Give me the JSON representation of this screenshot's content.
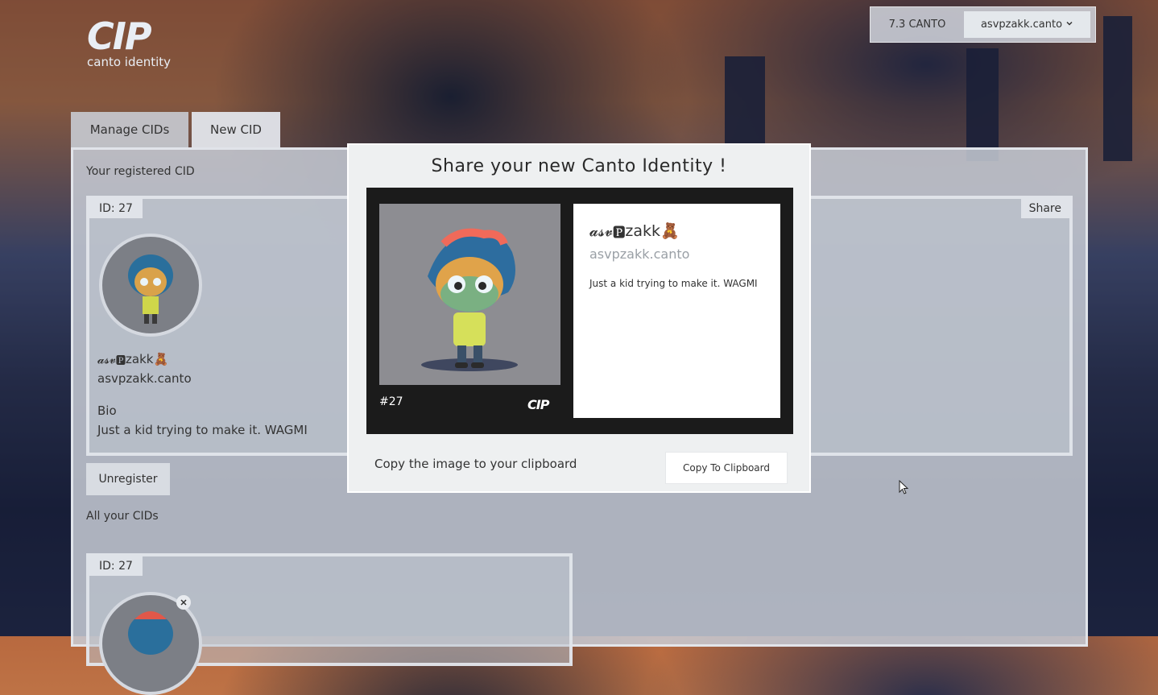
{
  "app": {
    "logo_text": "CIP",
    "logo_subtitle": "canto identity"
  },
  "wallet": {
    "balance": "7.3 CANTO",
    "account": "asvpzakk.canto",
    "chevron_icon": "chevron-down-icon"
  },
  "tabs": [
    {
      "label": "Manage CIDs"
    },
    {
      "label": "New CID"
    }
  ],
  "registered": {
    "section_label": "Your registered CID",
    "id_tag": "ID: 27",
    "share_label": "Share",
    "display_name": "𝓪𝓼𝓿🅿zakk🧸",
    "handle": "asvpzakk.canto",
    "bio_label": "Bio",
    "bio": "Just a kid trying to make it. WAGMI"
  },
  "unregister_label": "Unregister",
  "all_cids": {
    "section_label": "All your CIDs",
    "id_tag": "ID: 27"
  },
  "modal": {
    "title": "Share your new Canto Identity !",
    "card": {
      "number": "#27",
      "logo": "CIP",
      "display_name": "𝓪𝓼𝓿🅿zakk🧸",
      "handle": "asvpzakk.canto",
      "bio": "Just a kid trying to make it. WAGMI"
    },
    "copy_text": "Copy the image to your clipboard",
    "copy_button": "Copy To Clipboard"
  }
}
